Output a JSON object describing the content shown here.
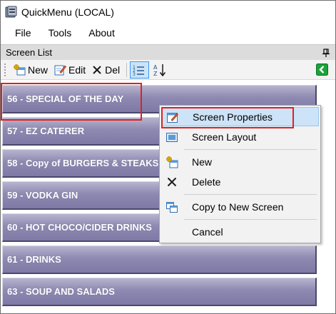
{
  "window": {
    "title": "QuickMenu (LOCAL)",
    "icon": "quickmenu-app-icon"
  },
  "menubar": {
    "items": [
      {
        "label": "File"
      },
      {
        "label": "Tools"
      },
      {
        "label": "About"
      }
    ]
  },
  "panel": {
    "title": "Screen List",
    "pin_icon": "pin-icon"
  },
  "toolbar": {
    "new_label": "New",
    "edit_label": "Edit",
    "del_label": "Del",
    "list_view_icon": "list-view-icon",
    "sort_icon": "sort-az-icon",
    "back_icon": "green-back-arrow-icon",
    "accent": "#1aa33a"
  },
  "screens": [
    {
      "label": "56 - SPECIAL OF THE DAY"
    },
    {
      "label": "57 - EZ CATERER"
    },
    {
      "label": "58 - Copy of BURGERS & STEAKS"
    },
    {
      "label": "59 - VODKA GIN"
    },
    {
      "label": "60 - HOT CHOCO/CIDER DRINKS"
    },
    {
      "label": "61 - DRINKS"
    },
    {
      "label": "63 - SOUP AND SALADS"
    }
  ],
  "context_menu": {
    "items": [
      {
        "label": "Screen Properties",
        "icon": "properties-icon",
        "selected": true
      },
      {
        "label": "Screen Layout",
        "icon": "layout-icon"
      },
      {
        "label": "New",
        "icon": "new-icon"
      },
      {
        "label": "Delete",
        "icon": "delete-x-icon"
      },
      {
        "label": "Copy to New Screen",
        "icon": "copy-icon"
      },
      {
        "label": "Cancel",
        "icon": ""
      }
    ]
  },
  "colors": {
    "screen_button": "#8d89b1",
    "highlight_red": "#e02020",
    "menu_selected": "#cde3f7"
  }
}
